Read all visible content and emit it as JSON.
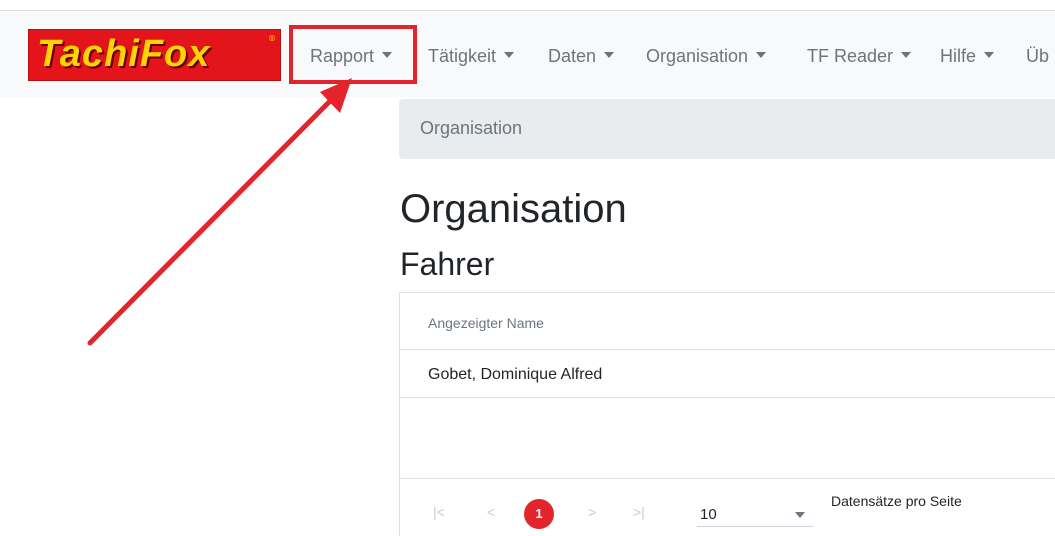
{
  "logo": {
    "text": "TachiFox",
    "reg_mark": "®"
  },
  "nav": {
    "items": [
      {
        "label": "Rapport"
      },
      {
        "label": "Tätigkeit"
      },
      {
        "label": "Daten"
      },
      {
        "label": "Organisation"
      },
      {
        "label": "TF Reader"
      },
      {
        "label": "Hilfe"
      },
      {
        "label": "Üb"
      }
    ]
  },
  "breadcrumb": {
    "current": "Organisation"
  },
  "page": {
    "title": "Organisation",
    "section_title": "Fahrer"
  },
  "table": {
    "columns": [
      "Angezeigter Name"
    ],
    "rows": [
      [
        "Gobet, Dominique Alfred"
      ]
    ]
  },
  "pager": {
    "first": "|<",
    "prev": "<",
    "current": "1",
    "next": ">",
    "last": ">|",
    "page_size": "10",
    "page_size_label": "Datensätze pro Seite"
  },
  "annotation": {
    "color": "#e3242b"
  },
  "colors": {
    "brand_red": "#e4141b",
    "brand_yellow": "#ffd400",
    "accent": "#e3242b"
  }
}
